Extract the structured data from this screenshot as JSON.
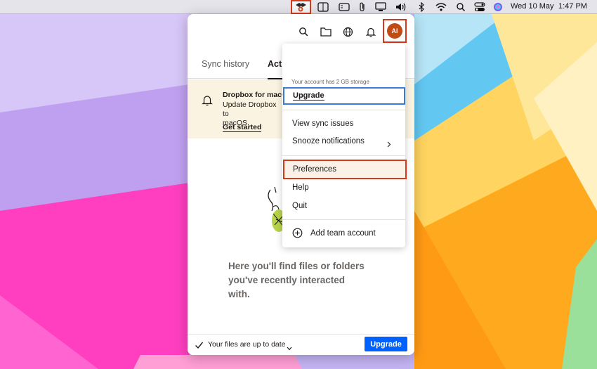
{
  "menubar": {
    "icons": [
      "dropbox-icon",
      "display-icon",
      "sidebar-icon",
      "paperclip-icon",
      "monitor-icon",
      "volume-icon",
      "bluetooth-icon",
      "wifi-icon",
      "search-icon",
      "control-center-icon",
      "siri-icon"
    ],
    "date": "Wed 10 May",
    "time": "1:47 PM"
  },
  "panel": {
    "header_icons": [
      "search-icon",
      "folder-icon",
      "globe-icon",
      "bell-icon"
    ],
    "avatar_initials": "AI",
    "tabs": [
      {
        "label": "Sync history"
      },
      {
        "label": "Acti"
      }
    ],
    "banner": {
      "title": "Dropbox for macC",
      "text_line1": "Update Dropbox to",
      "text_line2": "macOS.",
      "link": "Get started"
    },
    "empty_state": {
      "line1": "Here you'll find files or folders",
      "line2": "you've recently interacted",
      "line3": "with."
    },
    "footer": {
      "status": "Your files are up to date",
      "upgrade_label": "Upgrade"
    }
  },
  "account_menu": {
    "storage_text": "Your account has 2 GB storage",
    "upgrade_label": "Upgrade",
    "view_sync_issues": "View sync issues",
    "snooze_notifications": "Snooze notifications",
    "preferences": "Preferences",
    "help": "Help",
    "quit": "Quit",
    "add_team_account": "Add team account"
  },
  "colors": {
    "highlight": "#d63a1c",
    "focus_blue": "#3a7bd5",
    "upgrade_button": "#0061fe",
    "banner_bg": "#fbf3e1",
    "avatar_bg": "#c24a14"
  }
}
